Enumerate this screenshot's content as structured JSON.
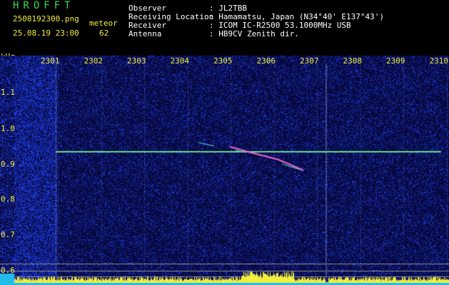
{
  "header": {
    "app_title": "HROFFT",
    "filename": "2508192300.png",
    "timestamp": "25.08.19 23:00",
    "mode_label": "meteor",
    "count": "62",
    "fields": [
      {
        "label": "Observer",
        "value": ": JL2TBB"
      },
      {
        "label": "Receiving Location",
        "value": ": Hamamatsu, Japan (N34°40' E137°43')"
      },
      {
        "label": "Receiver",
        "value": ": ICOM IC-R2500 53.1000MHz USB"
      },
      {
        "label": "Antenna",
        "value": ": HB9CV Zenith dir."
      }
    ]
  },
  "axis": {
    "y_unit": "kHz",
    "x_ticks": [
      "2301",
      "2302",
      "2303",
      "2304",
      "2305",
      "2306",
      "2307",
      "2308",
      "2309",
      "2310"
    ],
    "y_ticks": [
      "1.1",
      "1.0",
      "0.9",
      "0.8",
      "0.7",
      "0.6"
    ]
  },
  "colors": {
    "text_yellow": "#f2ee3a",
    "text_white": "#ffffff",
    "title_green": "#33dd55",
    "spectrogram_bg": "#0a0a3a",
    "carrier_line": "#66dd88",
    "meteor_trace": "#ee66cc",
    "bottom_bar": "#f2ee3a",
    "bottom_base": "#22bbee"
  }
}
